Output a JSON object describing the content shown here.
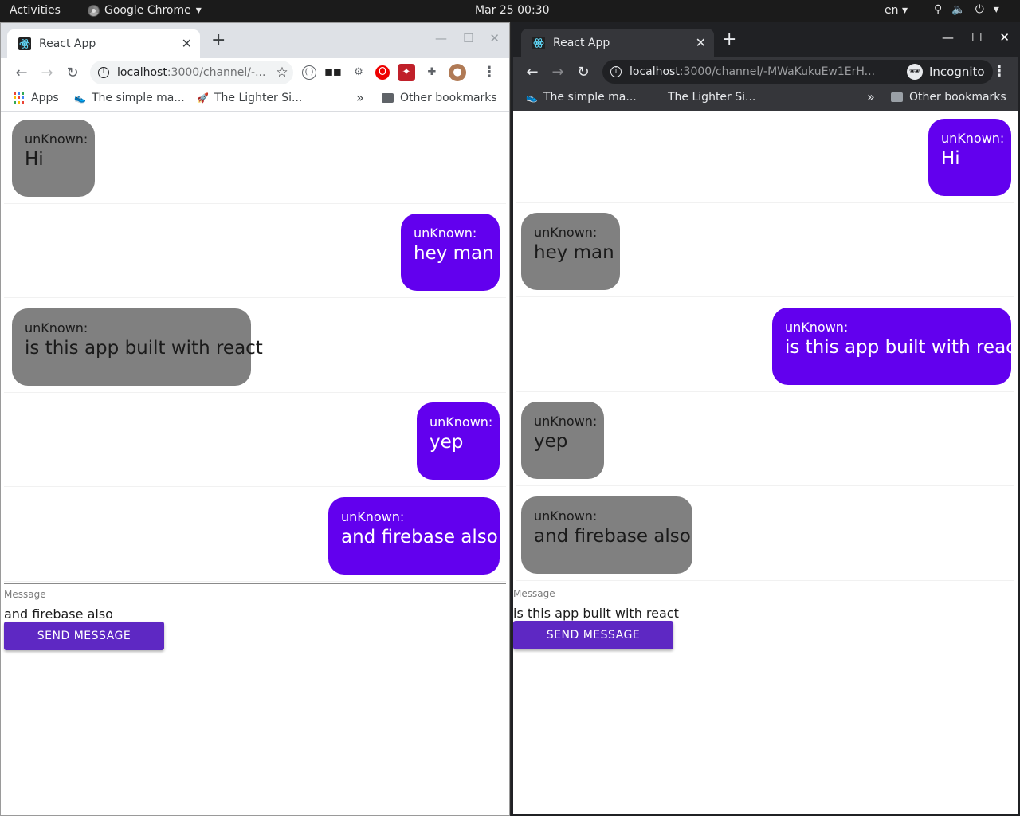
{
  "topbar": {
    "activities": "Activities",
    "app_name": "Google Chrome",
    "clock": "Mar 25  00:30",
    "lang": "en"
  },
  "left_window": {
    "tab_title": "React App",
    "url_host": "localhost",
    "url_rest": ":3000/channel/-...",
    "bookmarks": [
      "Apps",
      "The simple ma...",
      "The Lighter Si...",
      "Other bookmarks"
    ],
    "messages": [
      {
        "sender": "unKnown:",
        "text": "Hi",
        "side": "left",
        "color": "#808080"
      },
      {
        "sender": "unKnown:",
        "text": "hey man",
        "side": "right",
        "color": "#6200ee"
      },
      {
        "sender": "unKnown:",
        "text": "is this app built with react",
        "side": "left",
        "color": "#808080"
      },
      {
        "sender": "unKnown:",
        "text": "yep",
        "side": "right",
        "color": "#6200ee"
      },
      {
        "sender": "unKnown:",
        "text": "and firebase also",
        "side": "right",
        "color": "#6200ee"
      }
    ],
    "composer": {
      "label": "Message",
      "value": "and firebase also",
      "button": "SEND MESSAGE"
    }
  },
  "right_window": {
    "tab_title": "React App",
    "url_host": "localhost",
    "url_rest": ":3000/channel/-MWaKukuEw1ErH...",
    "incognito_label": "Incognito",
    "bookmarks": [
      "The simple ma...",
      "The Lighter Si...",
      "Other bookmarks"
    ],
    "messages": [
      {
        "sender": "unKnown:",
        "text": "Hi",
        "side": "right",
        "color": "#6200ee"
      },
      {
        "sender": "unKnown:",
        "text": "hey man",
        "side": "left",
        "color": "#808080"
      },
      {
        "sender": "unKnown:",
        "text": "is this app built with react",
        "side": "right",
        "color": "#6200ee"
      },
      {
        "sender": "unKnown:",
        "text": "yep",
        "side": "left",
        "color": "#808080"
      },
      {
        "sender": "unKnown:",
        "text": "and firebase also",
        "side": "left",
        "color": "#808080"
      }
    ],
    "composer": {
      "label": "Message",
      "value": "is this app built with react",
      "button": "SEND MESSAGE"
    }
  }
}
